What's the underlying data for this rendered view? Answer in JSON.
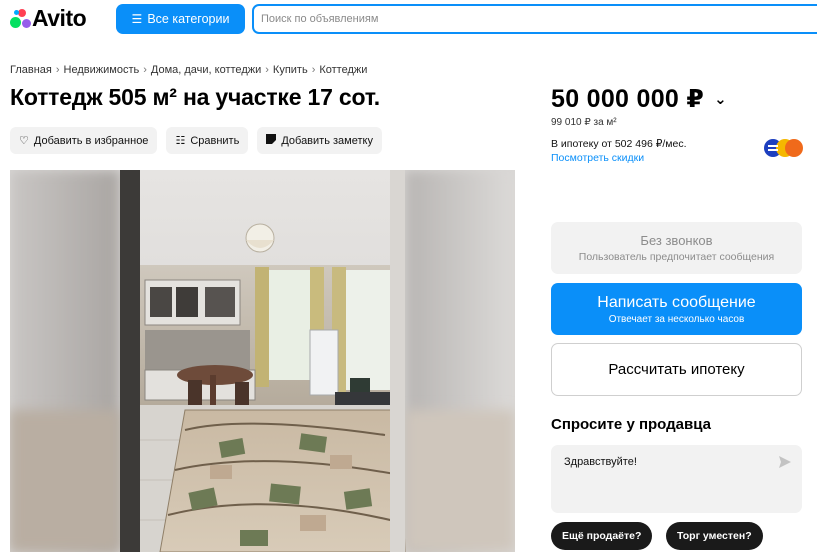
{
  "header": {
    "logo_text": "Avito",
    "categories_label": "Все категории",
    "categories_icon": "filter-list-icon",
    "search_placeholder": "Поиск по объявлениям"
  },
  "breadcrumb": [
    "Главная",
    "Недвижимость",
    "Дома, дачи, коттеджи",
    "Купить",
    "Коттеджи"
  ],
  "listing": {
    "title": "Коттедж 505 м² на участке 17 сот.",
    "actions": {
      "favorite": "Добавить в избранное",
      "compare": "Сравнить",
      "note": "Добавить заметку"
    }
  },
  "pricing": {
    "price": "50 000 000 ₽",
    "per_m2": "99 010 ₽ за м²",
    "mortgage": "В ипотеку от 502 496 ₽/мес.",
    "discounts_link": "Посмотреть скидки"
  },
  "contact": {
    "no_calls_title": "Без звонков",
    "no_calls_sub": "Пользователь предпочитает сообщения",
    "write_title": "Написать сообщение",
    "write_sub": "Отвечает за несколько часов",
    "calc_mortgage": "Рассчитать ипотеку"
  },
  "ask": {
    "title": "Спросите у продавца",
    "message": "Здравствуйте!",
    "chips": [
      "Ещё продаёте?",
      "Торг уместен?"
    ]
  },
  "colors": {
    "accent": "#0a8ff9",
    "chip_bg": "#1a1a1a",
    "secondary_bg": "#f2f2f2"
  }
}
